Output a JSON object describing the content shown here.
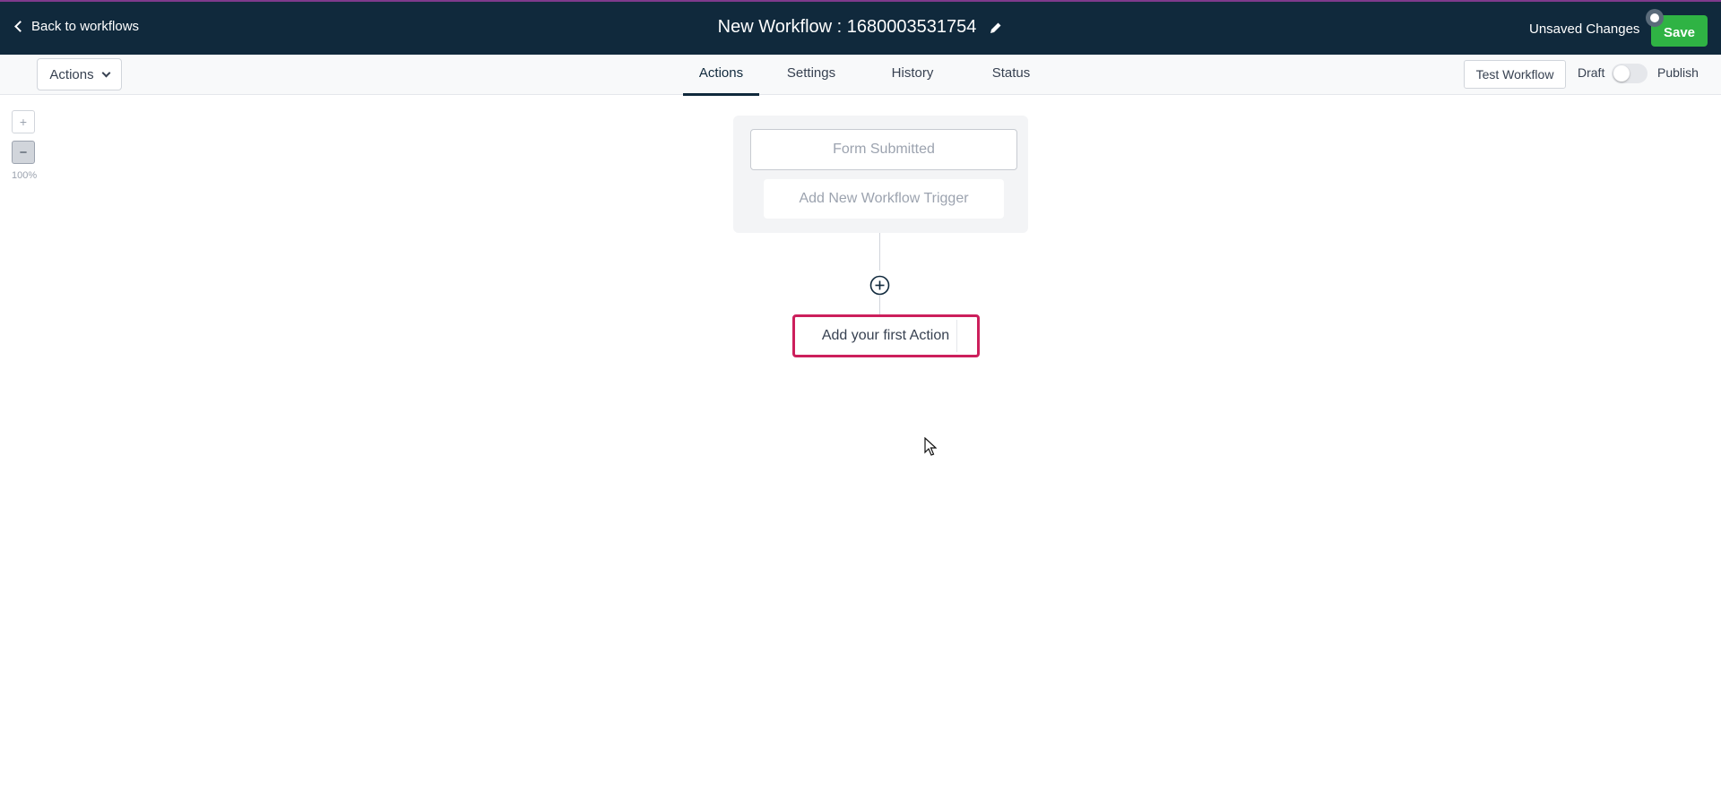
{
  "header": {
    "back_label": "Back to workflows",
    "title": "New Workflow : 1680003531754",
    "unsaved_label": "Unsaved Changes",
    "save_label": "Save"
  },
  "subbar": {
    "actions_dropdown_label": "Actions",
    "tabs": [
      {
        "label": "Actions",
        "active": true
      },
      {
        "label": "Settings",
        "active": false
      },
      {
        "label": "History",
        "active": false
      },
      {
        "label": "Status",
        "active": false
      }
    ],
    "test_workflow_label": "Test Workflow",
    "draft_label": "Draft",
    "publish_label": "Publish",
    "publish_toggle_on": false
  },
  "zoom": {
    "zoom_in_label": "+",
    "zoom_out_label": "−",
    "level": "100%"
  },
  "canvas": {
    "trigger_label": "Form Submitted",
    "add_trigger_label": "Add New Workflow Trigger",
    "first_action_label": "Add your first Action"
  },
  "colors": {
    "header_bg": "#10293c",
    "save_green": "#2fb344",
    "highlight_border": "#cc1f5c"
  },
  "icons": {
    "back": "chevron-left-icon",
    "edit_title": "pencil-icon",
    "dropdown": "chevron-down-icon",
    "add_step": "plus-circle-icon"
  }
}
